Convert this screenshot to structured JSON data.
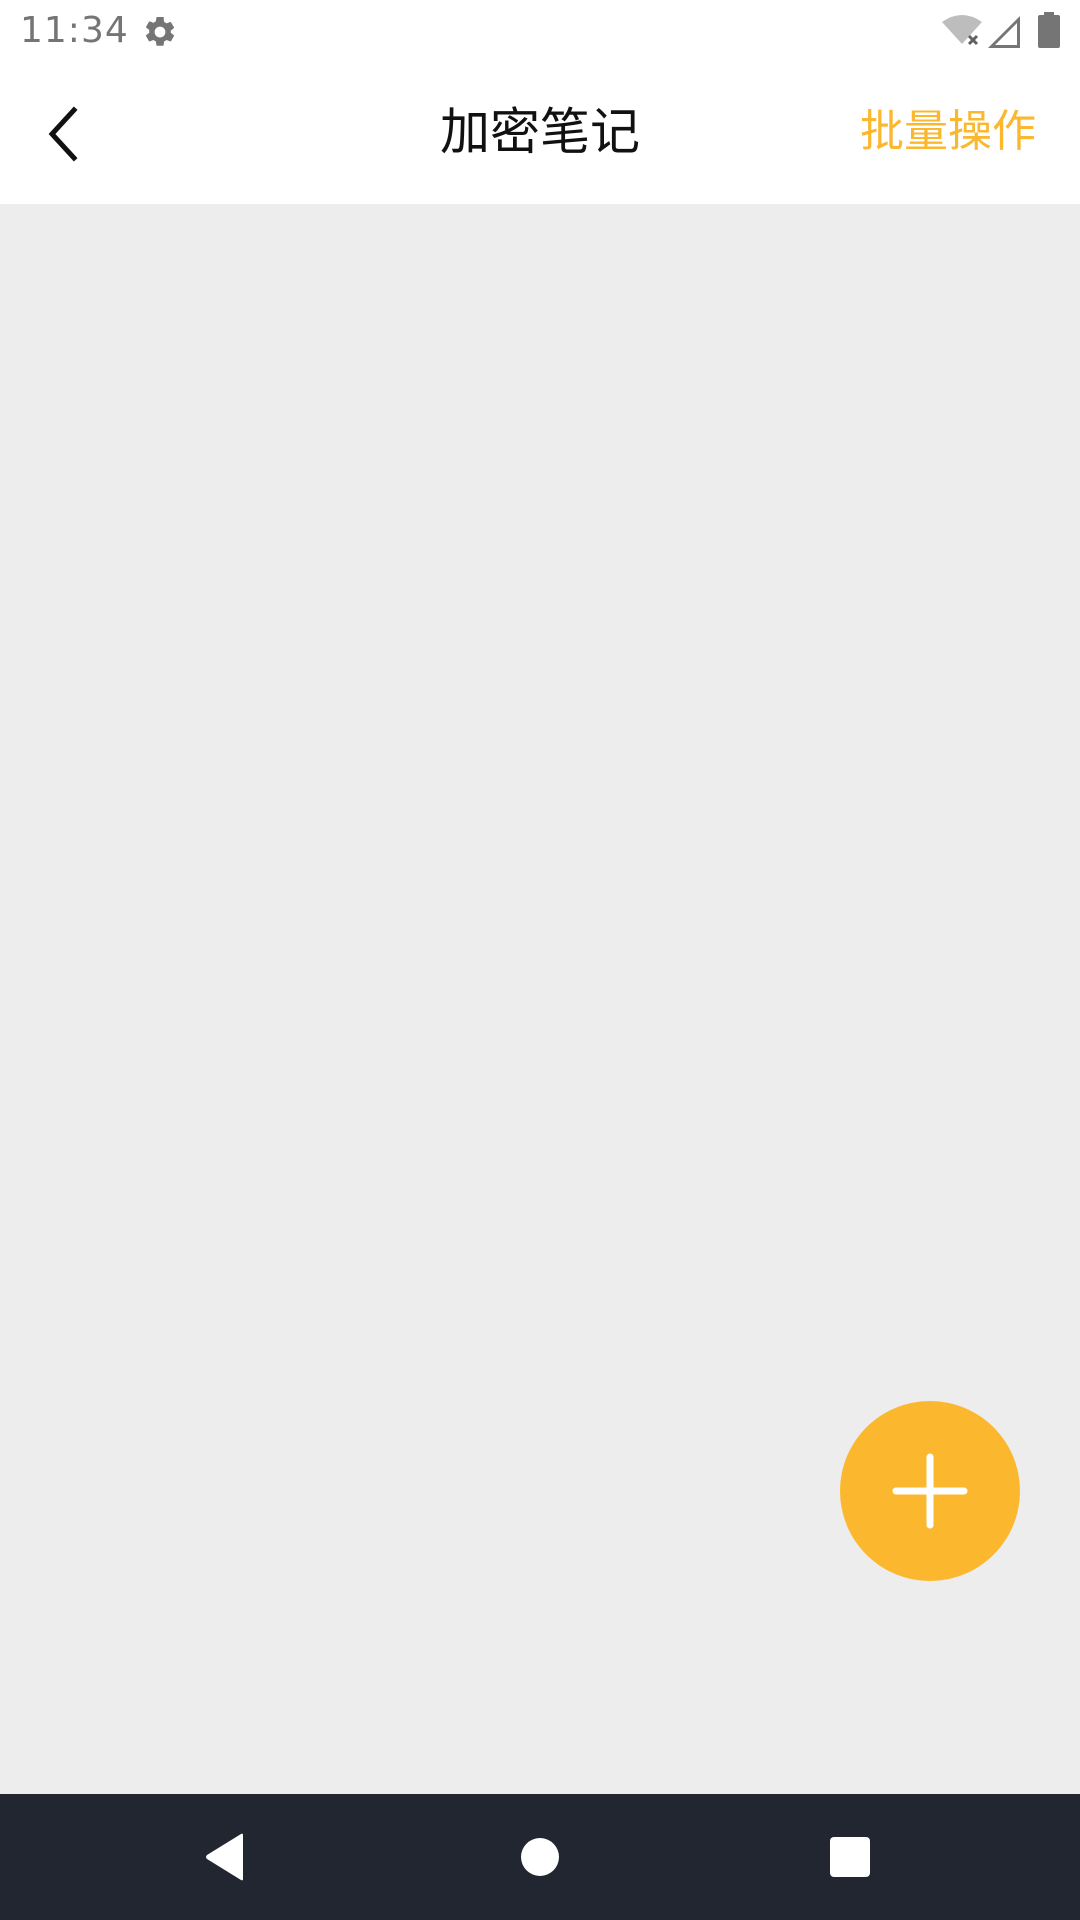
{
  "status_bar": {
    "time": "11:34",
    "icons": [
      "gear-icon",
      "wifi-off-icon",
      "cell-signal-icon",
      "battery-icon"
    ]
  },
  "app_bar": {
    "back_icon": "chevron-left-icon",
    "title": "加密笔记",
    "action_label": "批量操作"
  },
  "fab": {
    "icon": "plus-icon"
  },
  "nav_bar": {
    "icons": [
      "nav-back-icon",
      "nav-home-icon",
      "nav-recents-icon"
    ]
  },
  "colors": {
    "accent": "#fbb82e",
    "background": "#ededed",
    "app_bar_bg": "#ffffff",
    "nav_bar_bg": "#212631",
    "title_text": "#111111",
    "status_text": "#757575"
  }
}
